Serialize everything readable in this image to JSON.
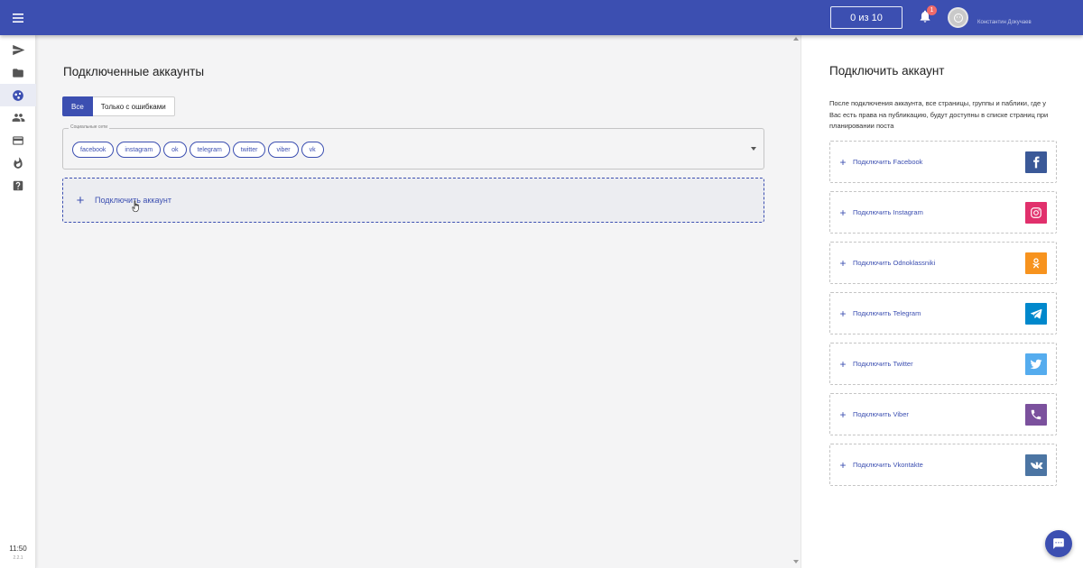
{
  "header": {
    "counter_label": "0 из 10",
    "notification_count": "1",
    "user_name": "Константин Докучаев"
  },
  "sidebar": {
    "items": [
      {
        "icon": "send-icon"
      },
      {
        "icon": "folder-icon"
      },
      {
        "icon": "social-networks-icon",
        "active": true
      },
      {
        "icon": "users-icon"
      },
      {
        "icon": "credit-card-icon"
      },
      {
        "icon": "fire-icon"
      },
      {
        "icon": "help-icon"
      }
    ],
    "time": "11:50",
    "version": "2.2.1"
  },
  "main": {
    "title": "Подключенные аккаунты",
    "filters": [
      "Все",
      "Только с ошибками"
    ],
    "networks_label": "Социальные сети",
    "chips": [
      "facebook",
      "instagram",
      "ok",
      "telegram",
      "twitter",
      "viber",
      "vk"
    ],
    "add_account_label": "Подключить аккаунт"
  },
  "right_panel": {
    "title": "Подключить аккаунт",
    "description": "После подключения аккаунта, все страницы, группы и паблики, где у Вас есть права на публикацию, будут доступны в списке страниц при планировании поста",
    "items": [
      {
        "label": "Подключить Facebook",
        "icon": "facebook-icon",
        "color": "#3b5998"
      },
      {
        "label": "Подключить Instagram",
        "icon": "instagram-icon",
        "color": "#e1306c"
      },
      {
        "label": "Подключить Odnoklassniki",
        "icon": "odnoklassniki-icon",
        "color": "#f7931e"
      },
      {
        "label": "Подключить Telegram",
        "icon": "telegram-icon",
        "color": "#0088cc"
      },
      {
        "label": "Подключить Twitter",
        "icon": "twitter-icon",
        "color": "#55acee"
      },
      {
        "label": "Подключить Viber",
        "icon": "viber-icon",
        "color": "#7b519d"
      },
      {
        "label": "Подключить Vkontakte",
        "icon": "vk-icon",
        "color": "#4c75a3"
      }
    ]
  },
  "colors": {
    "primary": "#3c4fb1",
    "background": "#f4f4f5"
  }
}
